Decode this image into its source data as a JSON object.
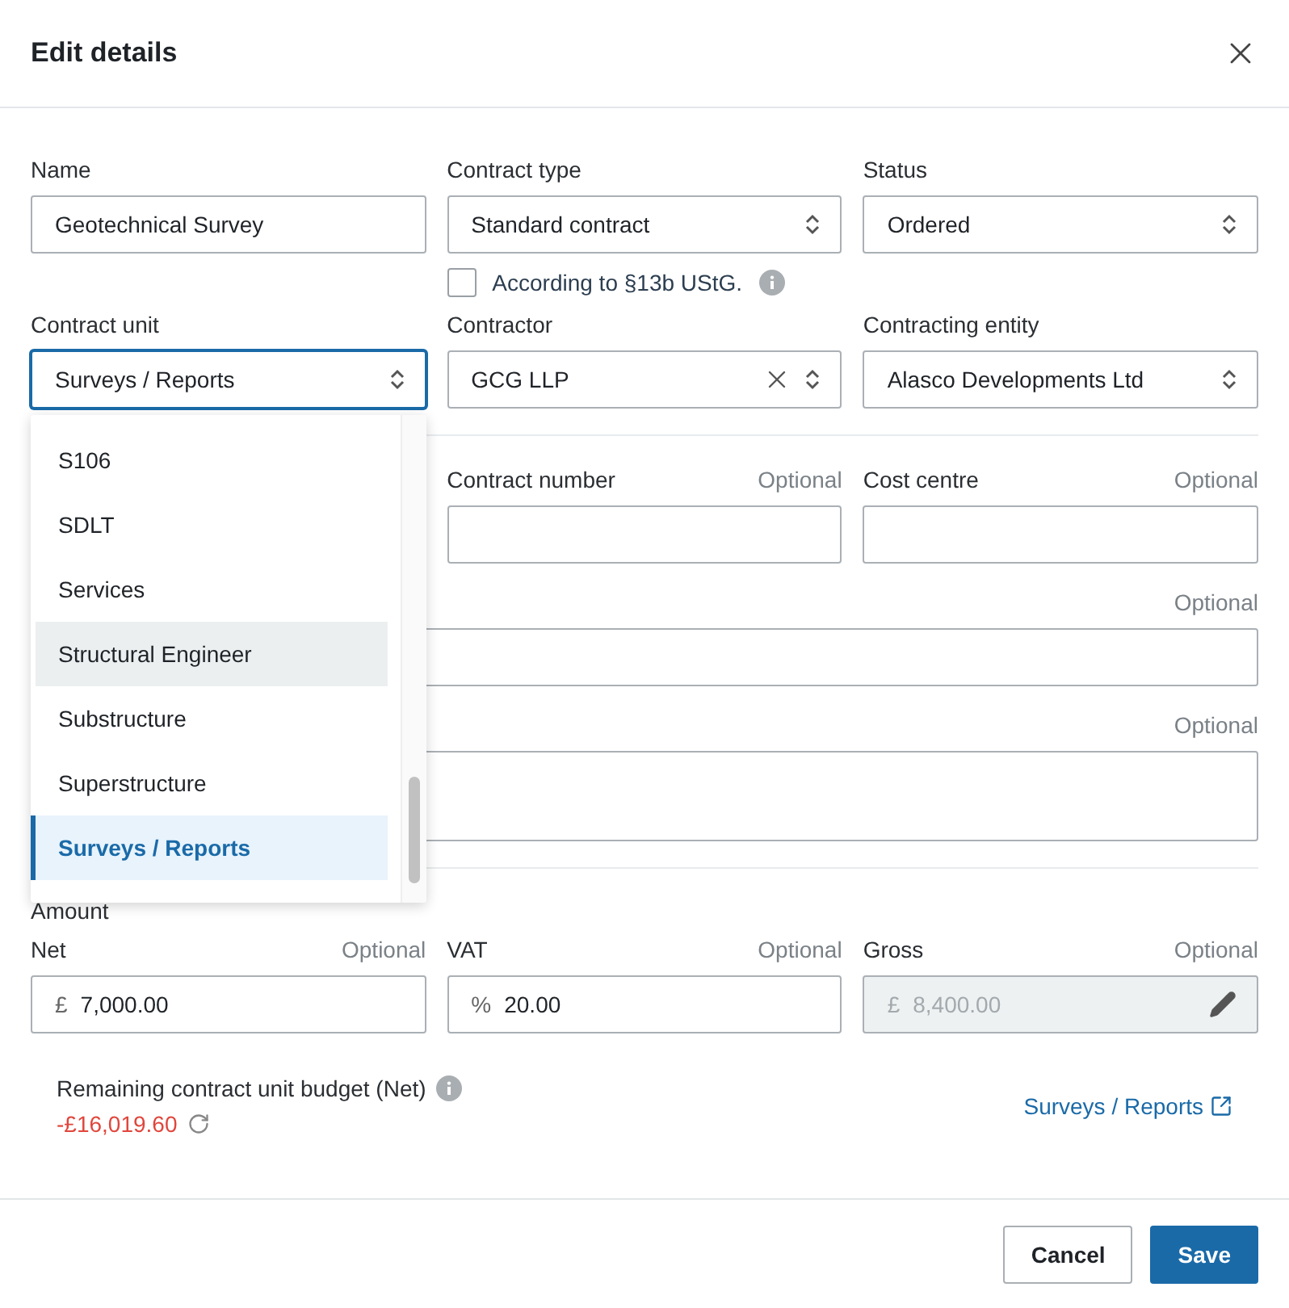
{
  "dialog": {
    "title": "Edit details"
  },
  "name": {
    "label": "Name",
    "value": "Geotechnical Survey"
  },
  "contract_type": {
    "label": "Contract type",
    "value": "Standard contract"
  },
  "status": {
    "label": "Status",
    "value": "Ordered"
  },
  "reverse_charge": {
    "label": "According to §13b UStG.",
    "checked": false
  },
  "contract_unit": {
    "label": "Contract unit",
    "value": "Surveys / Reports",
    "focused": true
  },
  "contractor": {
    "label": "Contractor",
    "value": "GCG LLP"
  },
  "contracting_entity": {
    "label": "Contracting entity",
    "value": "Alasco Developments Ltd"
  },
  "contract_number": {
    "label": "Contract number",
    "hint": "Optional"
  },
  "cost_centre": {
    "label": "Cost centre",
    "hint": "Optional"
  },
  "row_4": {
    "hint": "Optional"
  },
  "row_5": {
    "hint": "Optional"
  },
  "dropdown": {
    "options": [
      {
        "label": "S106",
        "selected": false,
        "hovered": false
      },
      {
        "label": "SDLT",
        "selected": false,
        "hovered": false
      },
      {
        "label": "Services",
        "selected": false,
        "hovered": false
      },
      {
        "label": "Structural Engineer",
        "selected": false,
        "hovered": true
      },
      {
        "label": "Substructure",
        "selected": false,
        "hovered": false
      },
      {
        "label": "Superstructure",
        "selected": false,
        "hovered": false
      },
      {
        "label": "Surveys / Reports",
        "selected": true,
        "hovered": false
      }
    ]
  },
  "amount": {
    "title": "Amount",
    "net": {
      "label": "Net",
      "hint": "Optional",
      "prefix": "£",
      "value": "7,000.00",
      "disabled": false
    },
    "vat": {
      "label": "VAT",
      "hint": "Optional",
      "prefix": "%",
      "value": "20.00",
      "disabled": false
    },
    "gross": {
      "label": "Gross",
      "hint": "Optional",
      "prefix": "£",
      "value": "8,400.00",
      "disabled": true
    }
  },
  "budget": {
    "label": "Remaining contract unit budget (Net)",
    "value": "-£16,019.60",
    "link": "Surveys / Reports"
  },
  "buttons": [
    {
      "label": "Cancel",
      "kind": "secondary"
    },
    {
      "label": "Save",
      "kind": "primary"
    }
  ]
}
